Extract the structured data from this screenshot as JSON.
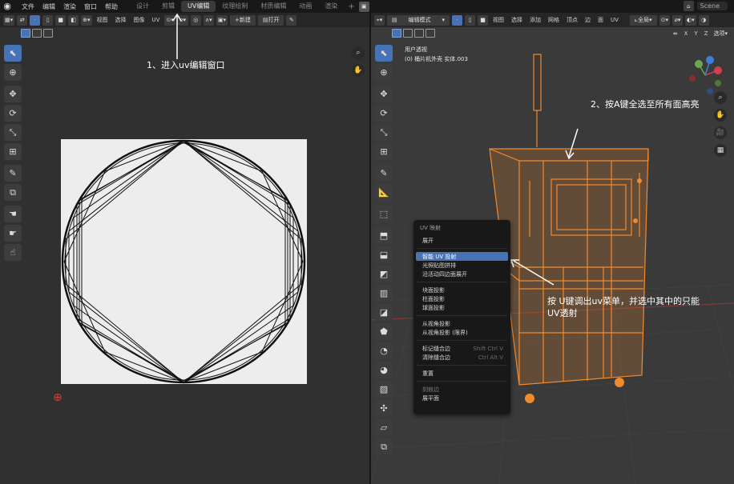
{
  "topbar": {
    "menus": [
      "文件",
      "编辑",
      "渲染",
      "窗口",
      "帮助"
    ],
    "workspace_tabs": [
      "设计",
      "剪辑",
      "UV编辑",
      "纹理绘制",
      "材质编辑",
      "动画",
      "渲染"
    ],
    "active_tab_index": 2,
    "scene": "Scene"
  },
  "uv_editor": {
    "header_menus": [
      "视图",
      "选择",
      "图像",
      "UV"
    ],
    "open_label": "打开",
    "new_label": "新建"
  },
  "viewport": {
    "mode": "编辑模式",
    "header_menus": [
      "视图",
      "选择",
      "添加",
      "网格",
      "顶点",
      "边",
      "面",
      "UV"
    ],
    "transform_orientation": "全局",
    "axes": [
      "X",
      "Y",
      "Z"
    ],
    "options_label": "选项",
    "info_line1": "用户透视",
    "info_line2": "(0) 桶片机外壳  实体.003"
  },
  "uv_menu": {
    "title": "UV 映射",
    "items": [
      {
        "label": "展开",
        "shortcut": "",
        "highlight": false,
        "disabled": false
      },
      {
        "sep": true
      },
      {
        "label": "智能 UV 投射",
        "shortcut": "",
        "highlight": true,
        "disabled": false
      },
      {
        "label": "光照贴图拼排",
        "shortcut": "",
        "highlight": false,
        "disabled": false
      },
      {
        "label": "沿活动四边面展开",
        "shortcut": "",
        "highlight": false,
        "disabled": false
      },
      {
        "sep": true
      },
      {
        "label": "块面投影",
        "shortcut": "",
        "highlight": false,
        "disabled": false
      },
      {
        "label": "柱面投影",
        "shortcut": "",
        "highlight": false,
        "disabled": false
      },
      {
        "label": "球面投影",
        "shortcut": "",
        "highlight": false,
        "disabled": false
      },
      {
        "sep": true
      },
      {
        "label": "从视角投影",
        "shortcut": "",
        "highlight": false,
        "disabled": false
      },
      {
        "label": "从视角投影 (限界)",
        "shortcut": "",
        "highlight": false,
        "disabled": false
      },
      {
        "sep": true
      },
      {
        "label": "标记缝合边",
        "shortcut": "Shift Ctrl V",
        "highlight": false,
        "disabled": false
      },
      {
        "label": "清除缝合边",
        "shortcut": "Ctrl Alt V",
        "highlight": false,
        "disabled": false
      },
      {
        "sep": true
      },
      {
        "label": "重置",
        "shortcut": "",
        "highlight": false,
        "disabled": false
      },
      {
        "sep": true
      },
      {
        "label": "刻痕边",
        "shortcut": "",
        "highlight": false,
        "disabled": true
      },
      {
        "label": "展平面",
        "shortcut": "",
        "highlight": false,
        "disabled": false
      }
    ]
  },
  "annotations": {
    "step1": "1、进入uv编辑窗口",
    "step2": "2、按A键全选至所有面高亮",
    "step3_line1": "按 U键调出uv菜单，并选中其中的只能",
    "step3_line2": "UV透射"
  },
  "colors": {
    "accent": "#4772b3",
    "selection_orange": "#f28a2e",
    "annotation_text": "#ffffff"
  }
}
